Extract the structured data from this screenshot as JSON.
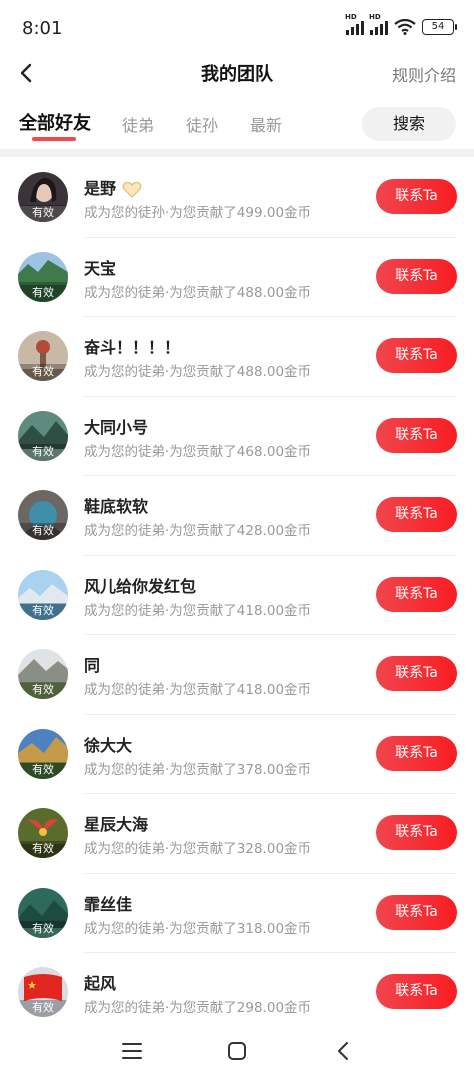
{
  "status_bar": {
    "time": "8:01",
    "hd1": "HD",
    "hd2": "HD",
    "battery": "54"
  },
  "nav": {
    "title": "我的团队",
    "rules": "规则介绍"
  },
  "tabs": [
    {
      "label": "全部好友",
      "active": true
    },
    {
      "label": "徒弟",
      "active": false
    },
    {
      "label": "徒孙",
      "active": false
    },
    {
      "label": "最新",
      "active": false
    }
  ],
  "search_label": "搜索",
  "contact_label": "联系Ta",
  "badge_label": "有效",
  "members": [
    {
      "name": "是野",
      "desc": "成为您的徒孙·为您贡献了499.00金币",
      "vip_badge": true
    },
    {
      "name": "天宝",
      "desc": "成为您的徒弟·为您贡献了488.00金币"
    },
    {
      "name": "奋斗！！！！",
      "desc": "成为您的徒弟·为您贡献了488.00金币"
    },
    {
      "name": "大同小号",
      "desc": "成为您的徒弟·为您贡献了468.00金币"
    },
    {
      "name": "鞋底软软",
      "desc": "成为您的徒弟·为您贡献了428.00金币"
    },
    {
      "name": "风儿给你发红包",
      "desc": "成为您的徒弟·为您贡献了418.00金币"
    },
    {
      "name": "同",
      "desc": "成为您的徒弟·为您贡献了418.00金币"
    },
    {
      "name": "徐大大",
      "desc": "成为您的徒弟·为您贡献了378.00金币"
    },
    {
      "name": "星辰大海",
      "desc": "成为您的徒弟·为您贡献了328.00金币"
    },
    {
      "name": "霏丝佳",
      "desc": "成为您的徒弟·为您贡献了318.00金币"
    },
    {
      "name": "起风",
      "desc": "成为您的徒弟·为您贡献了298.00金币"
    }
  ],
  "colors": {
    "accent": "#f81d22",
    "tab_underline": "#f2494b",
    "secondary_text": "#999999"
  }
}
